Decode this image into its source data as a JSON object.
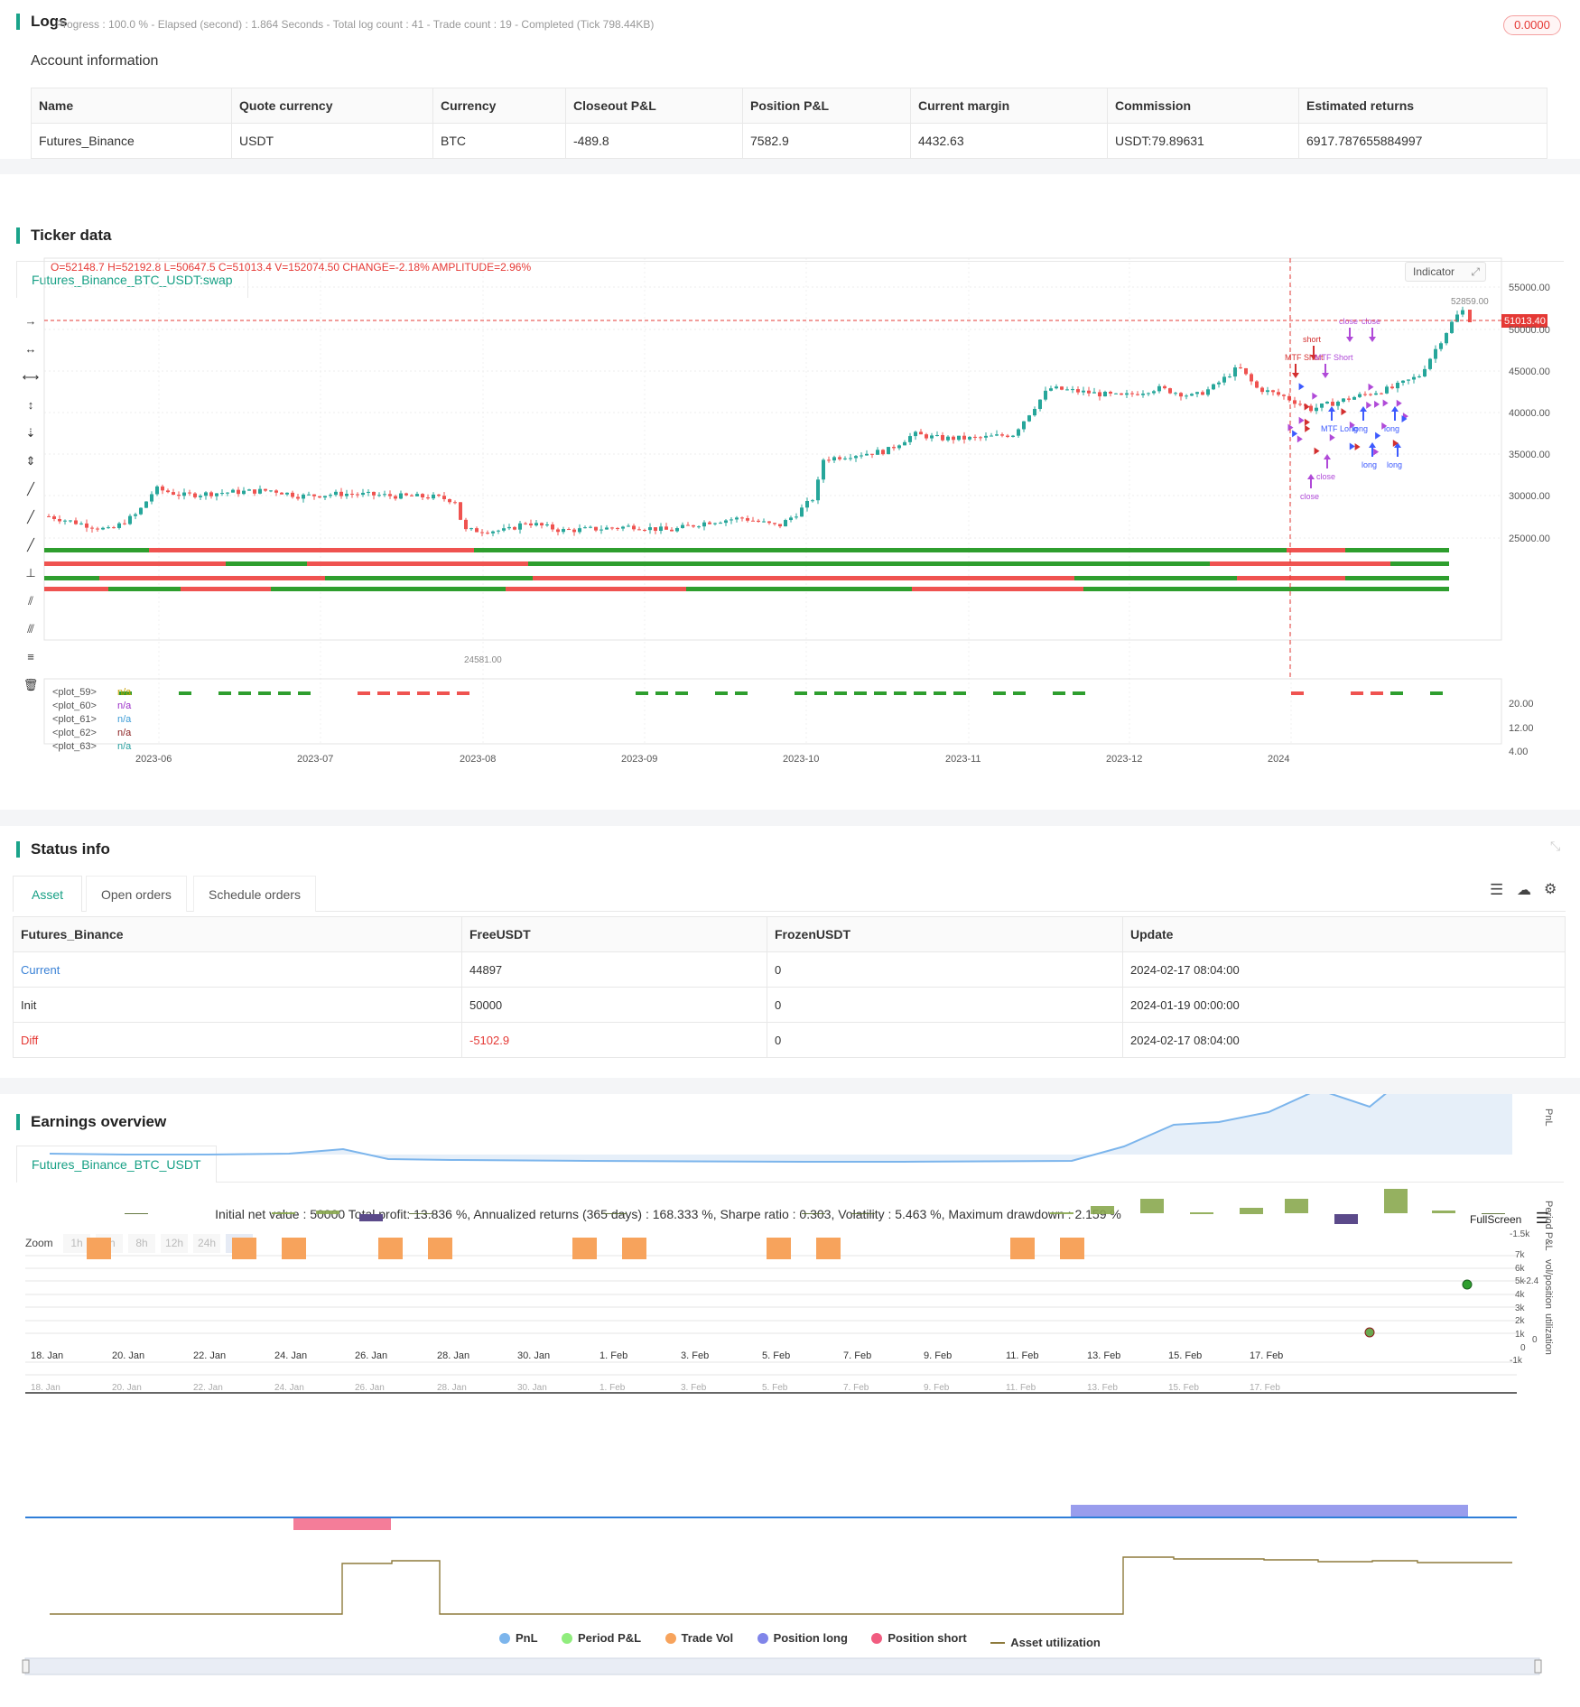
{
  "logs": {
    "title": "Logs",
    "status": "Progress : 100.0 % - Elapsed (second) : 1.864  Seconds - Total log count : 41 - Trade count : 19 - Completed (Tick 798.44KB)",
    "badge": "0.0000"
  },
  "account": {
    "heading": "Account information",
    "columns": [
      "Name",
      "Quote currency",
      "Currency",
      "Closeout P&L",
      "Position P&L",
      "Current margin",
      "Commission",
      "Estimated returns"
    ],
    "row": [
      "Futures_Binance",
      "USDT",
      "BTC",
      "-489.8",
      "7582.9",
      "4432.63",
      "USDT:79.89631",
      "6917.787655884997"
    ]
  },
  "ticker": {
    "heading": "Ticker data",
    "tab": "Futures_Binance_BTC_USDT:swap",
    "ohlc": {
      "o": "O=52148.7",
      "h": "H=52192.8",
      "l": "L=50647.5",
      "c": "C=51013.4",
      "v": "V=152074.50",
      "change": "CHANGE=-2.18%",
      "amp": "AMPLITUDE=2.96%"
    },
    "indicator_btn": "Indicator",
    "current_price": "51013.40",
    "high_label": "52859.00",
    "low_label": "24581.00",
    "price_ticks": [
      "55000.00",
      "50000.00",
      "45000.00",
      "40000.00",
      "35000.00",
      "30000.00",
      "25000.00"
    ],
    "ind_ticks": [
      "20.00",
      "12.00",
      "4.00"
    ],
    "date_ticks": [
      "2023-06",
      "2023-07",
      "2023-08",
      "2023-09",
      "2023-10",
      "2023-11",
      "2023-12",
      "2024"
    ],
    "plots": [
      {
        "name": "<plot_59>",
        "val": "n/a"
      },
      {
        "name": "<plot_60>",
        "val": "n/a"
      },
      {
        "name": "<plot_61>",
        "val": "n/a"
      },
      {
        "name": "<plot_62>",
        "val": "n/a"
      },
      {
        "name": "<plot_63>",
        "val": "n/a"
      }
    ],
    "trade_labels": [
      "short",
      "close",
      "close",
      "MTF Short",
      "MTF Short",
      "MTF Long",
      "long",
      "long",
      "long",
      "close",
      "close",
      "close"
    ]
  },
  "status": {
    "heading": "Status info",
    "tabs": [
      "Asset",
      "Open orders",
      "Schedule orders"
    ],
    "columns": [
      "Futures_Binance",
      "FreeUSDT",
      "FrozenUSDT",
      "Update"
    ],
    "rows": [
      [
        "Current",
        "44897",
        "0",
        "2024-02-17 08:04:00"
      ],
      [
        "Init",
        "50000",
        "0",
        "2024-01-19 00:00:00"
      ],
      [
        "Diff",
        "-5102.9",
        "0",
        "2024-02-17 08:04:00"
      ]
    ]
  },
  "earnings": {
    "heading": "Earnings overview",
    "tab": "Futures_Binance_BTC_USDT",
    "summary": "Initial net value : 50000  Total profit: 13.836 %, Annualized returns (365 days) : 168.333 %, Sharpe ratio : 0.303, Volatility : 5.463 %, Maximum drawdown : 2.159 %",
    "fullscreen": "FullScreen",
    "zoom_label": "Zoom",
    "zoom": [
      "1h",
      "3h",
      "8h",
      "12h",
      "24h",
      "All"
    ],
    "pnl_ticks": [
      "7k",
      "6k",
      "5k",
      "4k",
      "3k",
      "2k",
      "1k",
      "0",
      "-1k"
    ],
    "period_tick": "-1.5k",
    "pos_tick": "-2.4",
    "util_tick": "0",
    "axis_titles": [
      "PnL",
      "Period P&L",
      "vol/position",
      "utilization"
    ],
    "x_ticks": [
      "18. Jan",
      "20. Jan",
      "22. Jan",
      "24. Jan",
      "26. Jan",
      "28. Jan",
      "30. Jan",
      "1. Feb",
      "3. Feb",
      "5. Feb",
      "7. Feb",
      "9. Feb",
      "11. Feb",
      "13. Feb",
      "15. Feb",
      "17. Feb"
    ],
    "legend": [
      {
        "name": "PnL",
        "color": "#7cb5ec"
      },
      {
        "name": "Period P&L",
        "color": "#90ed7d"
      },
      {
        "name": "Trade Vol",
        "color": "#f7a35c"
      },
      {
        "name": "Position long",
        "color": "#8085e9"
      },
      {
        "name": "Position short",
        "color": "#f15c80"
      },
      {
        "name": "Asset utilization",
        "color": "#8d7a3c"
      }
    ]
  }
}
